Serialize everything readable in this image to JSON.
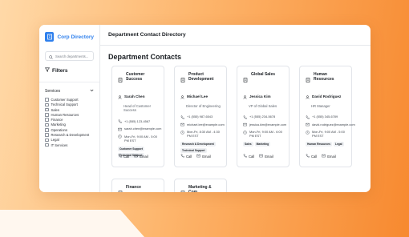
{
  "sidebar": {
    "brand": "Corp Directory",
    "search_placeholder": "Search departments...",
    "filters_title": "Filters",
    "services_label": "Services",
    "services": [
      "Customer Support",
      "Technical Support",
      "Sales",
      "Human Resources",
      "Finance",
      "Marketing",
      "Operations",
      "Research & Development",
      "Legal",
      "IT Services"
    ]
  },
  "header": {
    "title": "Department Contact Directory"
  },
  "main": {
    "heading": "Department Contacts"
  },
  "cards": [
    {
      "department": "Customer Success",
      "name": "Sarah Chen",
      "role": "Head of Customer Success",
      "phone": "+1 (555) 123-4567",
      "email": "sarah.chen@example.com",
      "hours": "Mon-Fri, 9:00 AM - 5:00 PM EST",
      "tags": [
        "Customer Support",
        "Technical Support"
      ],
      "call_label": "Call",
      "email_label": "Email"
    },
    {
      "department": "Product Development",
      "name": "Michael Lee",
      "role": "Director of Engineering",
      "phone": "+1 (555) 987-6543",
      "email": "michael.lee@example.com",
      "hours": "Mon-Fri, 8:30 AM - 4:30 PM EST",
      "tags": [
        "Research & Development",
        "Technical Support"
      ],
      "call_label": "Call",
      "email_label": "Email"
    },
    {
      "department": "Global Sales",
      "name": "Jessica Kim",
      "role": "VP of Global Sales",
      "phone": "+1 (555) 234-5678",
      "email": "jessica.kim@example.com",
      "hours": "Mon-Fri, 9:00 AM - 6:00 PM EST",
      "tags": [
        "Sales",
        "Marketing"
      ],
      "call_label": "Call",
      "email_label": "Email"
    },
    {
      "department": "Human Resources",
      "name": "David Rodriguez",
      "role": "HR Manager",
      "phone": "+1 (555) 345-6789",
      "email": "david.rodriguez@example.com",
      "hours": "Mon-Fri, 9:00 AM - 5:00 PM EST",
      "tags": [
        "Human Resources",
        "Legal"
      ],
      "call_label": "Call",
      "email_label": "Email"
    }
  ],
  "partial_cards": [
    {
      "department": "Finance"
    },
    {
      "department": "Marketing & Com"
    }
  ],
  "colors": {
    "accent": "#2f80ed",
    "background_orange": "#f7892f"
  }
}
